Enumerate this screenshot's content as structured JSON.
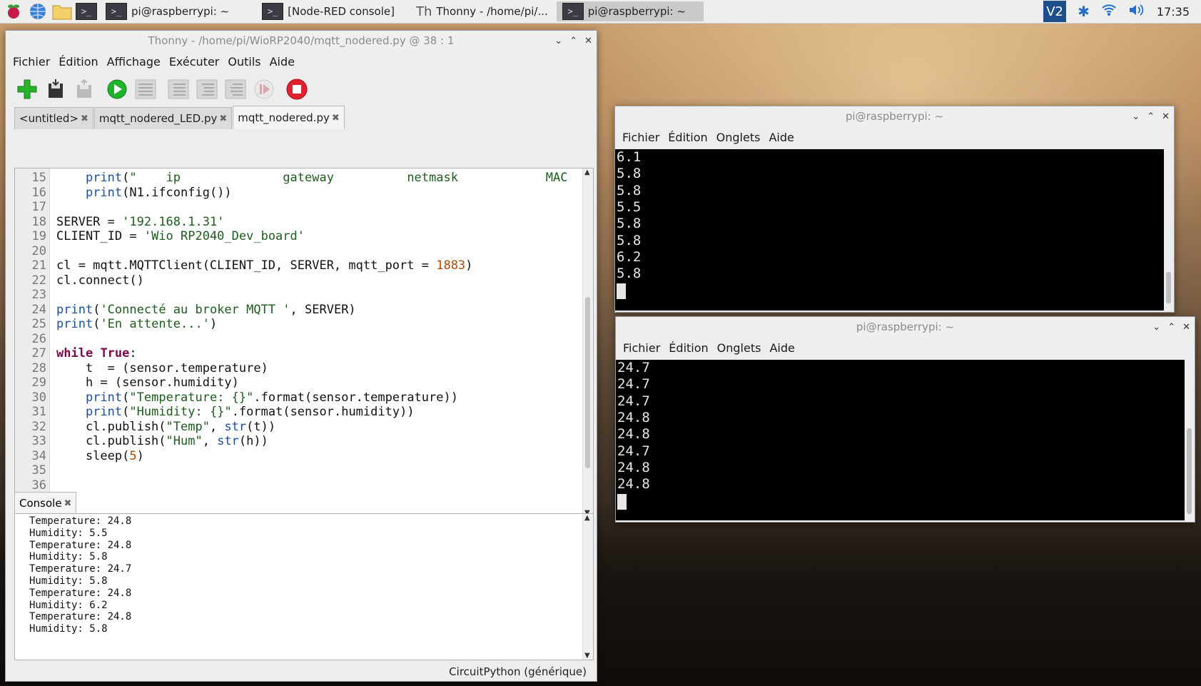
{
  "taskbar": {
    "buttons": [
      {
        "label": "pi@raspberrypi: ~",
        "icon": "terminal-icon",
        "active": false
      },
      {
        "label": "[Node-RED console]",
        "icon": "terminal-icon",
        "active": false
      },
      {
        "label": "Thonny  -  /home/pi/...",
        "icon": "thonny-icon",
        "active": false
      },
      {
        "label": "pi@raspberrypi: ~",
        "icon": "terminal-icon",
        "active": true
      }
    ],
    "clock": "17:35"
  },
  "thonny": {
    "title": "Thonny  -  /home/pi/WioRP2040/mqtt_nodered.py  @  38 : 1",
    "menu": [
      "Fichier",
      "Édition",
      "Affichage",
      "Exécuter",
      "Outils",
      "Aide"
    ],
    "tabs": [
      "<untitled>",
      "mqtt_nodered_LED.py",
      "mqtt_nodered.py"
    ],
    "code_lines": [
      {
        "n": "15",
        "text": "    print(\"    ip              gateway          netmask            MAC"
      },
      {
        "n": "16",
        "text": "    print(N1.ifconfig())"
      },
      {
        "n": "17",
        "text": ""
      },
      {
        "n": "18",
        "text": "SERVER = '192.168.1.31'"
      },
      {
        "n": "19",
        "text": "CLIENT_ID = 'Wio RP2040_Dev_board'"
      },
      {
        "n": "20",
        "text": ""
      },
      {
        "n": "21",
        "text": "cl = mqtt.MQTTClient(CLIENT_ID, SERVER, mqtt_port = 1883)"
      },
      {
        "n": "22",
        "text": "cl.connect()"
      },
      {
        "n": "23",
        "text": ""
      },
      {
        "n": "24",
        "text": "print('Connecté au broker MQTT ', SERVER)"
      },
      {
        "n": "25",
        "text": "print('En attente...')"
      },
      {
        "n": "26",
        "text": ""
      },
      {
        "n": "27",
        "text": "while True:"
      },
      {
        "n": "28",
        "text": "    t  = (sensor.temperature)"
      },
      {
        "n": "29",
        "text": "    h = (sensor.humidity)"
      },
      {
        "n": "30",
        "text": "    print(\"Temperature: {}\".format(sensor.temperature))"
      },
      {
        "n": "31",
        "text": "    print(\"Humidity: {}\".format(sensor.humidity))"
      },
      {
        "n": "32",
        "text": "    cl.publish(\"Temp\", str(t))"
      },
      {
        "n": "33",
        "text": "    cl.publish(\"Hum\", str(h))"
      },
      {
        "n": "34",
        "text": "    sleep(5)"
      },
      {
        "n": "35",
        "text": ""
      },
      {
        "n": "36",
        "text": ""
      }
    ],
    "console_tab": "Console",
    "console_lines": [
      "Temperature: 24.8",
      "Humidity: 5.5",
      "Temperature: 24.8",
      "Humidity: 5.8",
      "Temperature: 24.7",
      "Humidity: 5.8",
      "Temperature: 24.8",
      "Humidity: 6.2",
      "Temperature: 24.8",
      "Humidity: 5.8"
    ],
    "interpreter": "CircuitPython (générique)"
  },
  "term1": {
    "title": "pi@raspberrypi: ~",
    "menu": [
      "Fichier",
      "Édition",
      "Onglets",
      "Aide"
    ],
    "lines": [
      "6.1",
      "5.8",
      "5.8",
      "5.5",
      "5.8",
      "5.8",
      "6.2",
      "5.8"
    ]
  },
  "term2": {
    "title": "pi@raspberrypi: ~",
    "menu": [
      "Fichier",
      "Édition",
      "Onglets",
      "Aide"
    ],
    "lines": [
      "24.7",
      "24.7",
      "24.7",
      "24.8",
      "24.8",
      "24.7",
      "24.8",
      "24.8"
    ]
  }
}
